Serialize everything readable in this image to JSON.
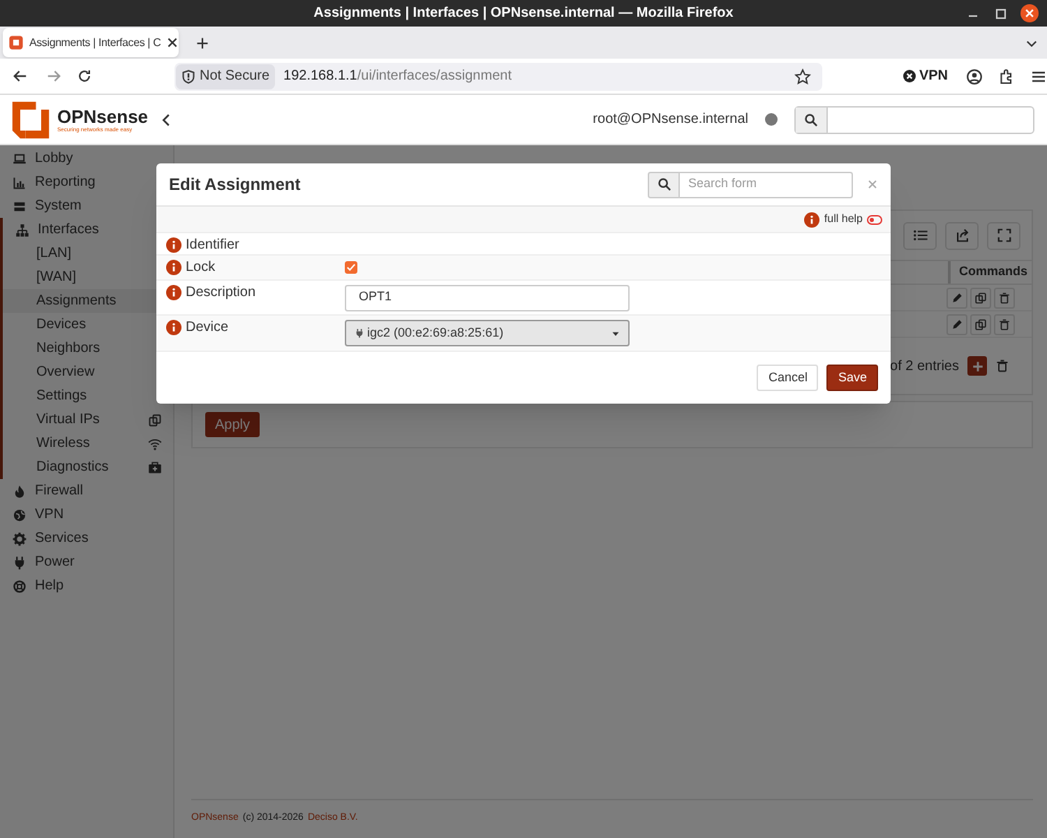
{
  "browser": {
    "window_title": "Assignments | Interfaces | OPNsense.internal — Mozilla Firefox",
    "tab_title": "Assignments | Interfaces | C",
    "security_label": "Not Secure",
    "url_host": "192.168.1.1",
    "url_path": "/ui/interfaces/assignment",
    "vpn_label": "VPN"
  },
  "header": {
    "brand": "OPNsense",
    "tagline": "Securing networks made easy",
    "user": "root@OPNsense.internal"
  },
  "sidebar": {
    "items": [
      {
        "label": "Lobby",
        "expanded": false
      },
      {
        "label": "Reporting",
        "expanded": false
      },
      {
        "label": "System",
        "expanded": false
      },
      {
        "label": "Interfaces",
        "expanded": true,
        "children": [
          {
            "label": "[LAN]",
            "selected": false
          },
          {
            "label": "[WAN]",
            "selected": false
          },
          {
            "label": "Assignments",
            "selected": true
          },
          {
            "label": "Devices",
            "selected": false
          },
          {
            "label": "Neighbors",
            "selected": false
          },
          {
            "label": "Overview",
            "selected": false
          },
          {
            "label": "Settings",
            "selected": false
          },
          {
            "label": "Virtual IPs",
            "selected": false
          },
          {
            "label": "Wireless",
            "selected": false
          },
          {
            "label": "Diagnostics",
            "selected": false
          }
        ]
      },
      {
        "label": "Firewall",
        "expanded": false
      },
      {
        "label": "VPN",
        "expanded": false
      },
      {
        "label": "Services",
        "expanded": false
      },
      {
        "label": "Power",
        "expanded": false
      },
      {
        "label": "Help",
        "expanded": false
      }
    ]
  },
  "table": {
    "columns": [
      {
        "label": "Commands"
      }
    ],
    "pagination": "of 2 entries"
  },
  "apply_button": "Apply",
  "footer": {
    "brand": "OPNsense",
    "text": "(c) 2014-2026",
    "company": "Deciso B.V."
  },
  "modal": {
    "title": "Edit Assignment",
    "search_placeholder": "Search form",
    "full_help_label": "full help",
    "full_help_on": false,
    "fields": [
      {
        "kind": "static",
        "label": "Identifier"
      },
      {
        "kind": "checkbox",
        "label": "Lock",
        "checked": true
      },
      {
        "kind": "text",
        "label": "Description",
        "value": "OPT1"
      },
      {
        "kind": "select",
        "label": "Device",
        "value": "igc2 (00:e2:69:a8:25:61)"
      }
    ],
    "buttons": [
      {
        "label": "Cancel",
        "kind": "default"
      },
      {
        "label": "Save",
        "kind": "primary"
      }
    ]
  }
}
